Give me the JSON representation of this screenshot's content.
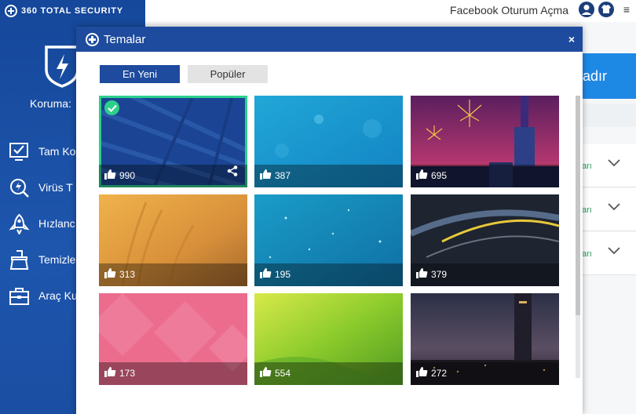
{
  "app": {
    "logo_text": "360 TOTAL SECURITY"
  },
  "header": {
    "facebook_login": "Facebook Oturum Açma"
  },
  "sidebar": {
    "protection_label": "Koruma:",
    "items": [
      {
        "label": "Tam Ko",
        "icon": "monitor-check-icon"
      },
      {
        "label": "Virüs T",
        "icon": "virus-scan-icon"
      },
      {
        "label": "Hızlanc",
        "icon": "rocket-icon"
      },
      {
        "label": "Temizle",
        "icon": "broom-icon"
      },
      {
        "label": "Araç Ku",
        "icon": "toolbox-icon"
      }
    ]
  },
  "background": {
    "button_text": "adır",
    "rows": [
      {
        "label": "arı"
      },
      {
        "label": "arı"
      },
      {
        "label": "arı"
      }
    ]
  },
  "modal": {
    "title": "Temalar",
    "close": "×",
    "tabs": [
      {
        "label": "En Yeni",
        "active": true
      },
      {
        "label": "Popüler",
        "active": false
      }
    ],
    "themes": [
      {
        "likes": "990",
        "selected": true,
        "style": "blue-lines"
      },
      {
        "likes": "387",
        "selected": false,
        "style": "cyan-bokeh"
      },
      {
        "likes": "695",
        "selected": false,
        "style": "fireworks-city"
      },
      {
        "likes": "313",
        "selected": false,
        "style": "golden-wheat"
      },
      {
        "likes": "195",
        "selected": false,
        "style": "teal-particles"
      },
      {
        "likes": "379",
        "selected": false,
        "style": "dark-light-streaks"
      },
      {
        "likes": "173",
        "selected": false,
        "style": "pink-diamonds"
      },
      {
        "likes": "554",
        "selected": false,
        "style": "green-meadow"
      },
      {
        "likes": "272",
        "selected": false,
        "style": "night-tower-city"
      }
    ]
  },
  "colors": {
    "sidebar": "#1a4ea3",
    "modal_header": "#1e4b9e",
    "selected_outline": "#2cd08c",
    "background_button": "#1e88e5"
  }
}
